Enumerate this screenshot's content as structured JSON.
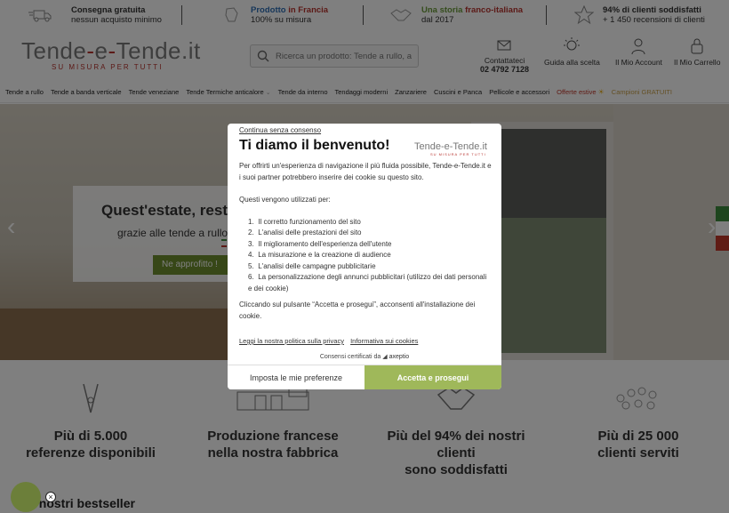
{
  "infobar": {
    "items": [
      {
        "bold": "Consegna gratuita",
        "sub": "nessun acquisto minimo",
        "icon": "delivery-truck-icon"
      },
      {
        "bold_part1": "Prodotto",
        "bold_part2": " in Francia",
        "sub": "100% su misura",
        "icon": "french-product-icon"
      },
      {
        "bold_part1": "Una storia",
        "bold_part2": " franco-italiana",
        "sub": "dal 2017",
        "icon": "handshake-icon"
      },
      {
        "bold": "94% di clienti soddisfatti",
        "sub": "+ 1 450 recensioni di clienti",
        "icon": "star-icon"
      }
    ]
  },
  "header": {
    "logo_part1": "Tende",
    "logo_dash": "-",
    "logo_part2": "e",
    "logo_dash2": "-",
    "logo_part3": "Tende.it",
    "logo_tagline": "SU MISURA PER TUTTI",
    "search_placeholder": "Ricerca un prodotto: Tende a rullo, a l",
    "contact_label": "Contattateci",
    "contact_phone": "02 4792 7128",
    "help_label": "Guida alla scelta",
    "account_label": "Il Mio Account",
    "cart_label": "Il Mio Carrello"
  },
  "nav": {
    "items": [
      "Tende a rullo",
      "Tende a banda verticale",
      "Tende veneziane",
      "Tende Termiche anticalore",
      "Tende da interno",
      "Tendaggi moderni",
      "Zanzariere",
      "Cuscini e Panca",
      "Pellicole e accessori"
    ],
    "offers": "Offerte estive",
    "samples": "Campioni GRATUITI"
  },
  "hero": {
    "heading": "Quest'estate, resta",
    "subheading": "grazie alle tende a rullo",
    "cta": "Ne approfitto !"
  },
  "features": [
    {
      "line1": "Più di 5.000",
      "line2": "referenze disponibili",
      "icon": "sewing-needle-icon"
    },
    {
      "line1": "Produzione francese",
      "line2": "nella nostra fabbrica",
      "icon": "factory-icon"
    },
    {
      "line1": "Più del 94% dei nostri",
      "line2": "clienti",
      "line3": "sono soddisfatti",
      "icon": "handshake-icon"
    },
    {
      "line1": "Più di 25 000",
      "line2": "clienti serviti",
      "icon": "crowd-icon"
    }
  ],
  "bestseller_title": "I nostri bestseller",
  "modal": {
    "skip": "Continua senza consenso",
    "title": "Ti diamo il benvenuto!",
    "logo": "Tende-e-Tende.it",
    "logo_tagline": "SU MISURA PER TUTTI",
    "intro": "Per offrirti un'esperienza di navigazione il più fluida possibile, Tende-e-Tende.it e i suoi partner potrebbero inserire dei cookie su questo sito.",
    "used_for": "Questi vengono utilizzati per:",
    "purposes": [
      "Il corretto funzionamento del sito",
      "L'analisi delle prestazioni del sito",
      "Il miglioramento dell'esperienza dell'utente",
      "La misurazione e la creazione di audience",
      "L'analisi delle campagne pubblicitarie",
      "La personalizzazione degli annunci pubblicitari (utilizzo dei dati personali e dei cookie)"
    ],
    "accept_note": "Cliccando sul pulsante “Accetta e prosegui”, acconsenti all'installazione dei cookie.",
    "privacy_link": "Leggi la nostra politica sulla privacy",
    "cookie_link": "Informativa sui cookies",
    "certified": "Consensi certificati da",
    "certifier": "axeptio",
    "prefs_button": "Imposta le mie preferenze",
    "accept_button": "Accetta e prosegui"
  },
  "colors": {
    "brand_red": "#b8342f",
    "brand_green": "#6f8f2f",
    "accept_green": "#9fb85a"
  }
}
